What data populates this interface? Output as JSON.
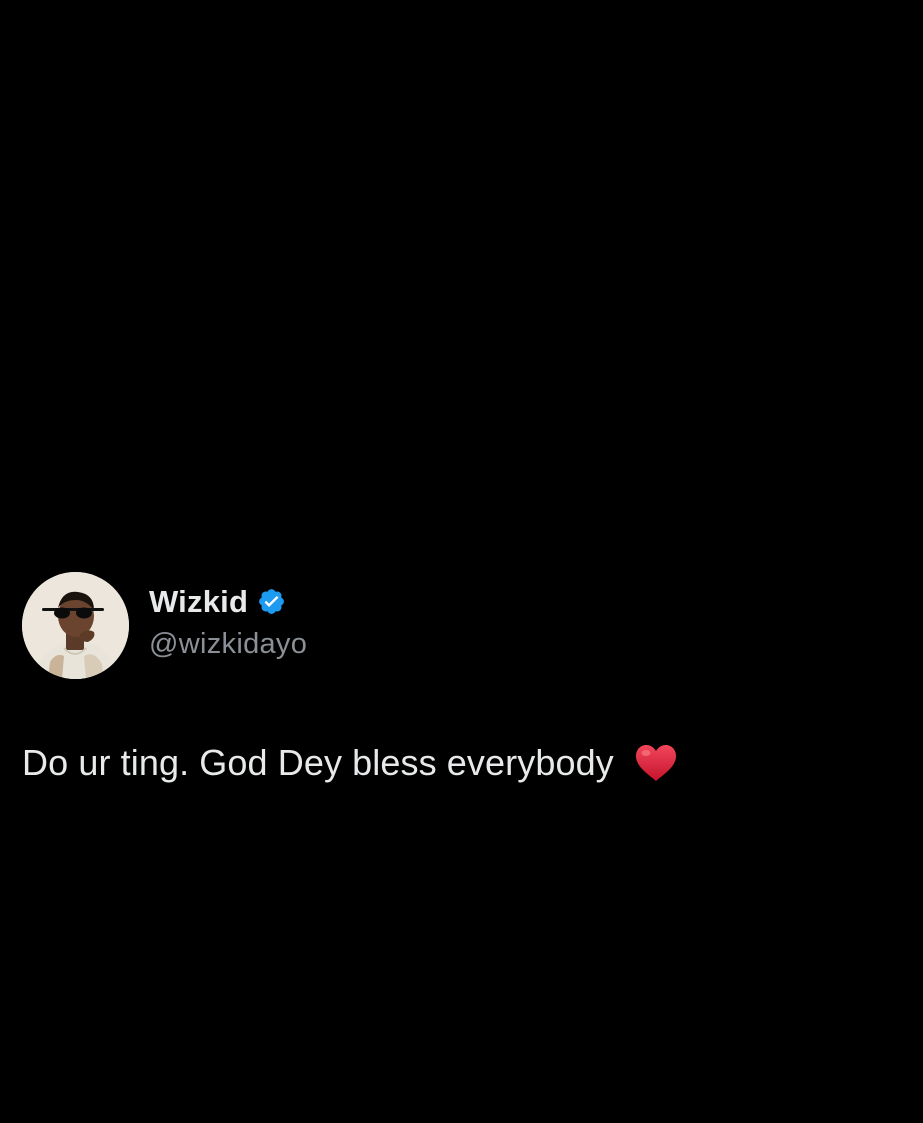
{
  "tweet": {
    "author": {
      "display_name": "Wizkid",
      "handle": "@wizkidayo",
      "verified": true,
      "avatar": "profile-photo"
    },
    "text": "Do ur ting. God Dey bless everybody",
    "emoji": "red-heart-icon"
  },
  "colors": {
    "background": "#000000",
    "text_primary": "#e7e9ea",
    "text_secondary": "#8b9096",
    "verified_blue": "#1d9bf0",
    "heart_red": "#e0243a"
  }
}
